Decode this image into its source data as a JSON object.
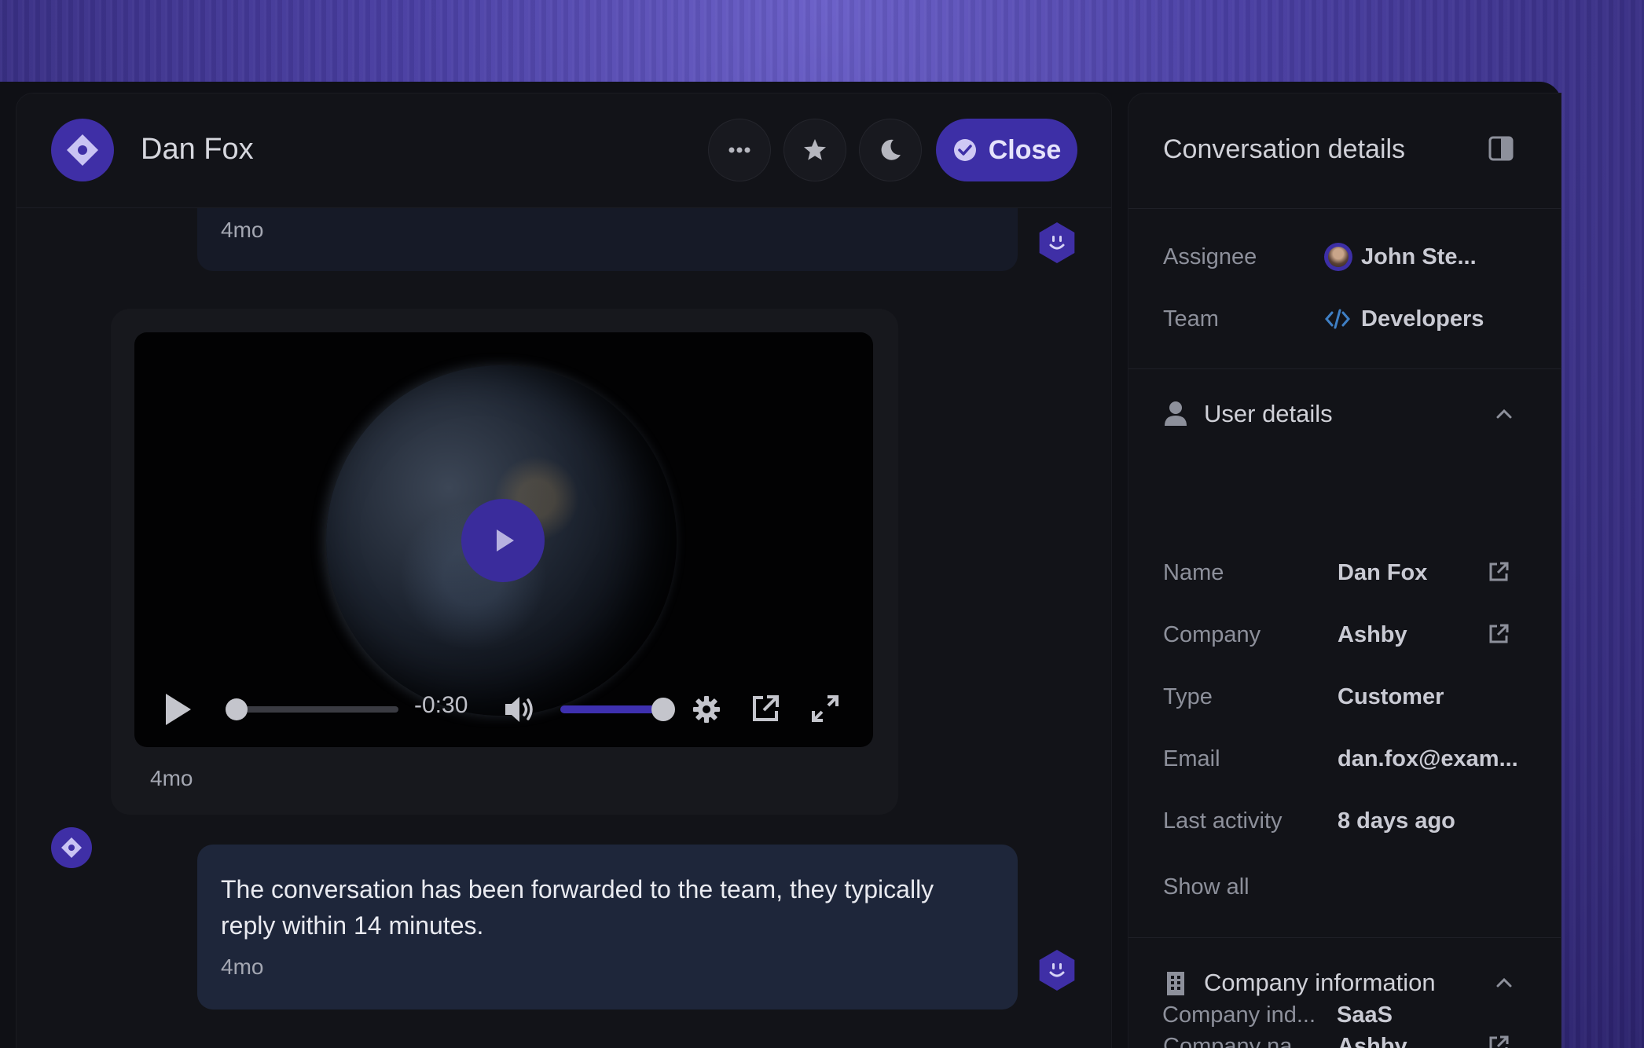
{
  "header": {
    "title": "Dan Fox",
    "close_label": "Close"
  },
  "messages": {
    "top_time": "4mo",
    "video": {
      "time_remaining": "-0:30",
      "progress": 0,
      "volume": 1.0,
      "time": "4mo"
    },
    "bottom": {
      "text": "The conversation has been forwarded to the team, they typically reply within 14 minutes.",
      "time": "4mo"
    }
  },
  "sidebar": {
    "title": "Conversation details",
    "assignee_label": "Assignee",
    "assignee_value": "John Ste...",
    "team_label": "Team",
    "team_value": "Developers",
    "user_details": {
      "title": "User details",
      "name_label": "Name",
      "name_value": "Dan Fox",
      "company_label": "Company",
      "company_value": "Ashby",
      "type_label": "Type",
      "type_value": "Customer",
      "email_label": "Email",
      "email_value": "dan.fox@exam...",
      "last_activity_label": "Last activity",
      "last_activity_value": "8 days ago",
      "show_all": "Show all"
    },
    "company_info": {
      "title": "Company information",
      "company_name_label": "Company na...",
      "company_name_value": "Ashby",
      "company_industry_label": "Company ind...",
      "company_industry_value": "SaaS"
    }
  },
  "colors": {
    "accent": "#3d2fa6",
    "background": "#121318",
    "message_bubble": "#1e263a"
  }
}
